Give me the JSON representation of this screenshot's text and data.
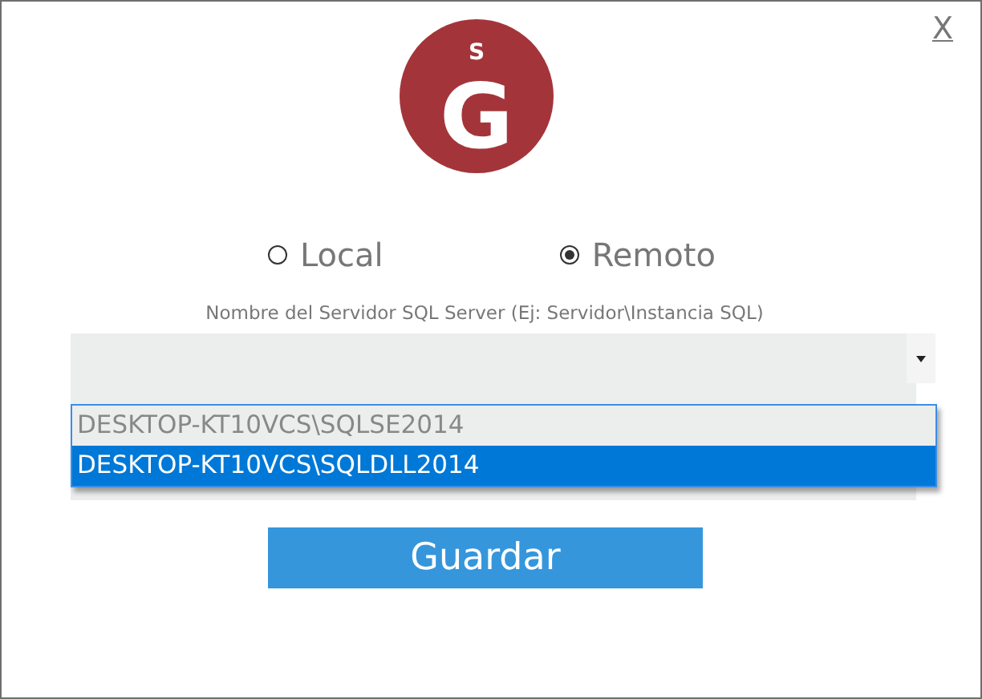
{
  "close_button": {
    "label": "X"
  },
  "logo": {
    "small_letter": "S",
    "big_letter": "G"
  },
  "server_mode": [
    {
      "label": "Local",
      "selected": false
    },
    {
      "label": "Remoto",
      "selected": true
    }
  ],
  "server_field": {
    "label": "Nombre del Servidor SQL Server (Ej: Servidor\\Instancia SQL)",
    "options": [
      {
        "label": "DESKTOP-KT10VCS\\SQLSE2014",
        "selected": false
      },
      {
        "label": "DESKTOP-KT10VCS\\SQLDLL2014",
        "selected": true
      }
    ]
  },
  "buttons": [
    {
      "label": "Guardar"
    }
  ]
}
